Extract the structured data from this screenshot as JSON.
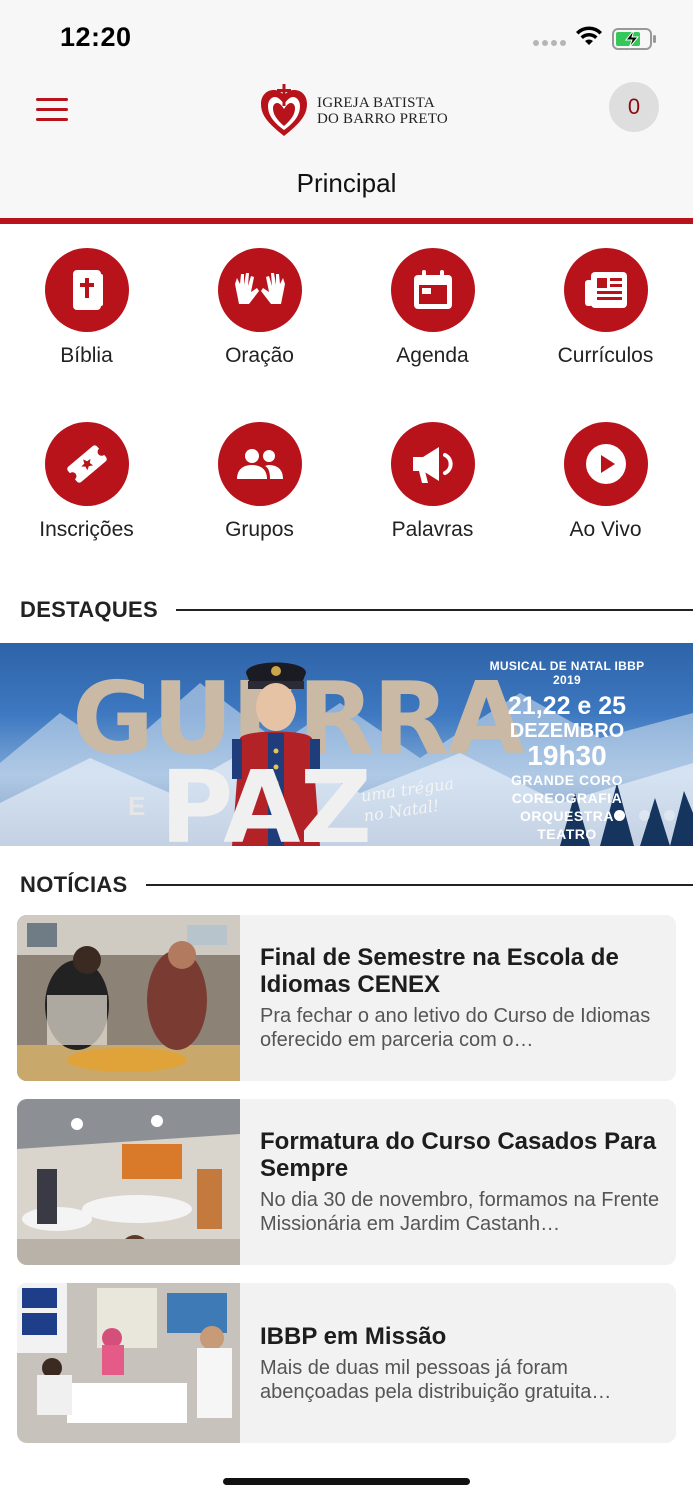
{
  "status": {
    "time": "12:20"
  },
  "header": {
    "logo_line1": "IGREJA BATISTA",
    "logo_line2": "DO BARRO PRETO",
    "cart_count": "0",
    "page_title": "Principal"
  },
  "shortcuts": [
    {
      "label": "Bíblia",
      "icon": "bible-icon"
    },
    {
      "label": "Oração",
      "icon": "praying-hands-icon"
    },
    {
      "label": "Agenda",
      "icon": "calendar-icon"
    },
    {
      "label": "Currículos",
      "icon": "newspaper-icon"
    },
    {
      "label": "Inscrições",
      "icon": "ticket-icon"
    },
    {
      "label": "Grupos",
      "icon": "group-icon"
    },
    {
      "label": "Palavras",
      "icon": "megaphone-icon"
    },
    {
      "label": "Ao Vivo",
      "icon": "play-icon"
    }
  ],
  "highlights": {
    "title": "DESTAQUES",
    "banner": {
      "word1": "GUERRA",
      "connector": "E",
      "word2": "PAZ",
      "tagline_1": "uma trégua",
      "tagline_2": "no Natal!",
      "event": "MUSICAL DE NATAL IBBP 2019",
      "dates": "21,22 e 25",
      "month": "DEZEMBRO",
      "time": "19h30",
      "line1": "GRANDE CORO",
      "line2": "COREOGRAFIA",
      "line3": "ORQUESTRA",
      "line4": "TEATRO"
    },
    "active_slide": 1,
    "slide_count": 3
  },
  "news": {
    "title": "NOTÍCIAS",
    "items": [
      {
        "title": "Final de Semestre na Escola de Idiomas CENEX",
        "excerpt": "Pra fechar o ano letivo do Curso de Idiomas oferecido em parceria com o…"
      },
      {
        "title": "Formatura do Curso Casados Para Sempre",
        "excerpt": "No dia 30 de novembro, formamos na Frente Missionária em Jardim Castanh…"
      },
      {
        "title": "IBBP em Missão",
        "excerpt": "Mais de duas mil pessoas já foram abençoadas pela distribuição gratuita…"
      }
    ]
  },
  "colors": {
    "accent": "#b8121b",
    "header_bg": "#f7f7f7",
    "card_bg": "#f2f2f2"
  }
}
